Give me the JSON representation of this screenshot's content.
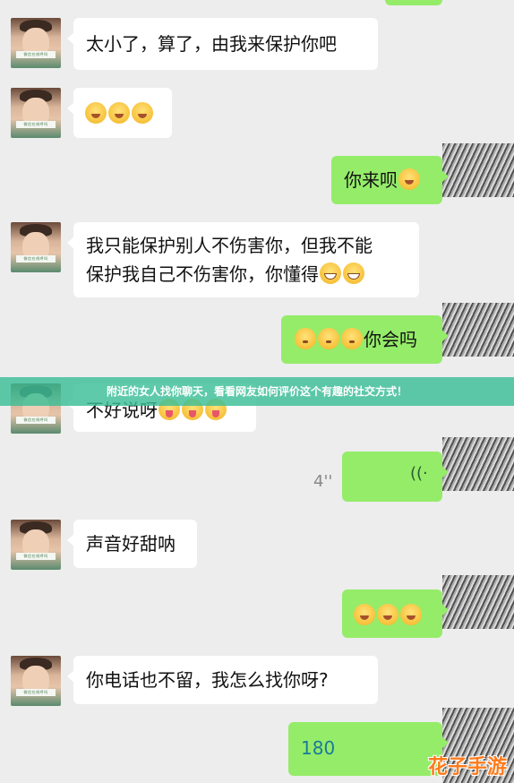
{
  "messages": [
    {
      "side": "left",
      "text": "太小了，算了，由我来保护你吧",
      "emoji": []
    },
    {
      "side": "left",
      "text": "",
      "emoji": [
        "blush",
        "blush",
        "blush"
      ]
    },
    {
      "side": "right",
      "text": "你来呗",
      "emoji": [
        "blush"
      ]
    },
    {
      "side": "left",
      "line1": "我只能保护别人不伤害你，但我不能",
      "line2": "保护我自己不伤害你，你懂得",
      "emoji": [
        "grin",
        "grin"
      ]
    },
    {
      "side": "right",
      "text": "你会吗",
      "emoji_before": [
        "shy",
        "shy",
        "shy"
      ]
    },
    {
      "side": "left",
      "text": "不好说呀",
      "emoji": [
        "tongue",
        "tongue",
        "tongue"
      ]
    },
    {
      "side": "right",
      "type": "voice",
      "duration": "4''"
    },
    {
      "side": "left",
      "text": "声音好甜呐"
    },
    {
      "side": "right",
      "emoji": [
        "blush",
        "blush",
        "blush"
      ]
    },
    {
      "side": "left",
      "text": "你电话也不留，我怎么找你呀?"
    },
    {
      "side": "right",
      "text": "180"
    }
  ],
  "avatar_tag": "微信在线呼叫",
  "banner": "附近的女人找你聊天，看看网友如何评价这个有趣的社交方式！",
  "voice_icon": "((·",
  "watermark": "花子手游"
}
